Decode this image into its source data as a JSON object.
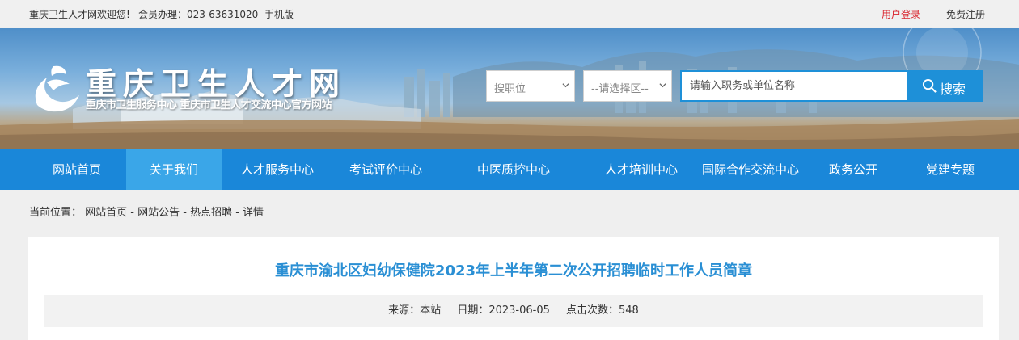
{
  "topbar": {
    "welcome": "重庆卫生人才网欢迎您!",
    "member": "会员办理：023-63631020",
    "mobile": "手机版",
    "login": "用户登录",
    "register": "免费注册"
  },
  "header": {
    "title": "重庆卫生人才网",
    "subtitle": "重庆市卫生服务中心  重庆市卫生人才交流中心官方网站"
  },
  "search": {
    "position_select": "搜职位",
    "region_select": "--请选择区--",
    "placeholder": "请输入职务或单位名称",
    "button_label": "搜索"
  },
  "nav": {
    "items": [
      {
        "label": "网站首页"
      },
      {
        "label": "关于我们"
      },
      {
        "label": "人才服务中心"
      },
      {
        "label": "考试评价中心"
      },
      {
        "label": "中医质控中心"
      },
      {
        "label": "人才培训中心"
      },
      {
        "label": "国际合作交流中心"
      },
      {
        "label": "政务公开"
      },
      {
        "label": "党建专题"
      }
    ],
    "active_index": 1
  },
  "breadcrumb": {
    "prefix": "当前位置：",
    "path": "网站首页 - 网站公告 - 热点招聘 - 详情"
  },
  "article": {
    "title": "重庆市渝北区妇幼保健院2023年上半年第二次公开招聘临时工作人员简章",
    "source": "来源：本站",
    "date": "日期：2023-06-05",
    "views": "点击次数：548"
  },
  "colors": {
    "nav_bg": "#1a87d9",
    "nav_active": "#3aa6e8",
    "title_blue": "#2a8fd4",
    "login_red": "#d9232d"
  }
}
